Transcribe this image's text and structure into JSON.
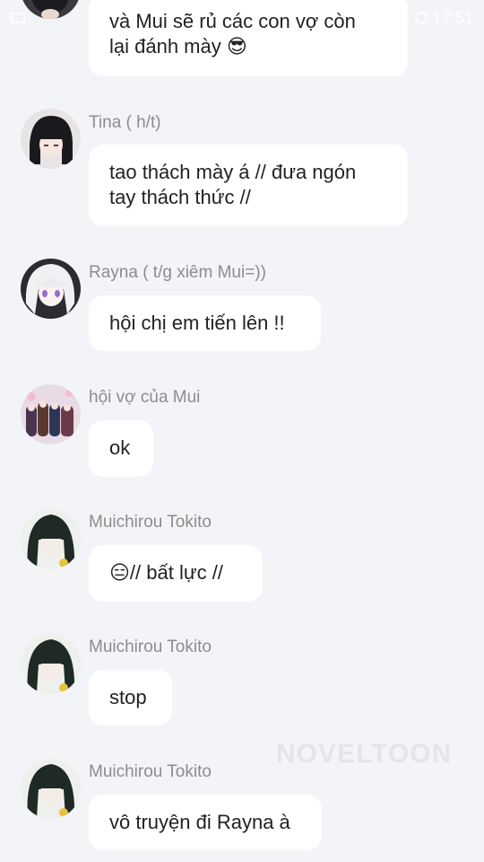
{
  "status_bar": {
    "time": "17:51"
  },
  "watermark": "NOVELTOON",
  "messages": [
    {
      "sender": "",
      "text_line1": "và Mui sẽ rủ các con vợ còn",
      "text_line2": "lại đánh mày 😎"
    },
    {
      "sender": "Tina ( h/t)",
      "text_line1": "tao thách mày á // đưa ngón",
      "text_line2": "tay thách thức //"
    },
    {
      "sender": "Rayna ( t/g xiêm Mui=))",
      "text": "hội chị em tiến lên !!"
    },
    {
      "sender": "hội vợ của Mui",
      "text": "ok"
    },
    {
      "sender": "Muichirou Tokito",
      "text": "😑// bất lực //"
    },
    {
      "sender": "Muichirou Tokito",
      "text": "stop"
    },
    {
      "sender": "Muichirou Tokito",
      "text": "vô truyện đi Rayna à"
    }
  ]
}
